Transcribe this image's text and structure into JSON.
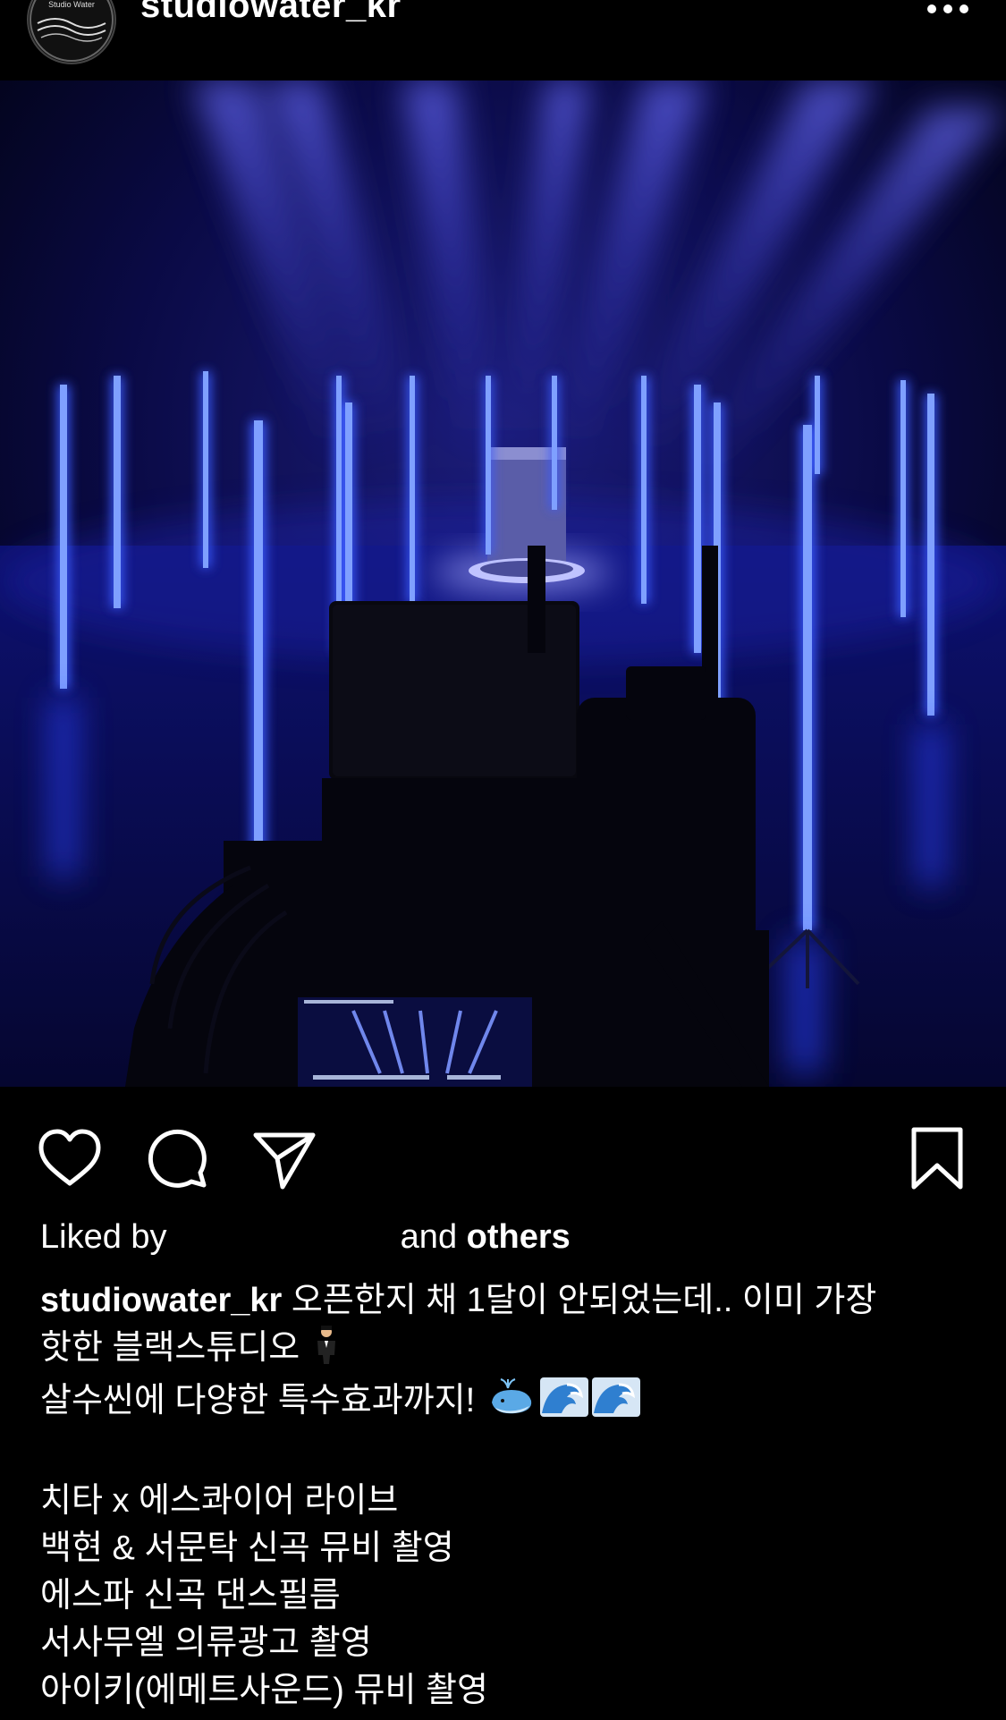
{
  "header": {
    "username": "studiowater_kr",
    "avatar_text": "Studio Water",
    "more_icon": "more-horizontal-icon"
  },
  "media": {
    "description_icon": "studio-photo"
  },
  "actions": {
    "like_icon": "heart-icon",
    "comment_icon": "comment-icon",
    "share_icon": "send-icon",
    "save_icon": "bookmark-icon"
  },
  "likes": {
    "prefix": "Liked by",
    "and": "and",
    "others": "others"
  },
  "caption": {
    "username": "studiowater_kr",
    "line1": "오픈한지 채 1달이 안되었는데.. 이미 가장",
    "line2": "핫한 블랙스튜디오",
    "line3": "살수씬에 다양한 특수효과까지!",
    "list": [
      "치타 x 에스콰이어 라이브",
      "백현 & 서문탁 신곡 뮤비 촬영",
      "에스파 신곡 댄스필름",
      "서사무엘 의류광고 촬영",
      "아이키(에메트사운드) 뮤비 촬영"
    ]
  },
  "colors": {
    "background": "#000000",
    "text": "#ffffff",
    "light_tube": "#3a5cff",
    "beam": "#4a4dff"
  }
}
